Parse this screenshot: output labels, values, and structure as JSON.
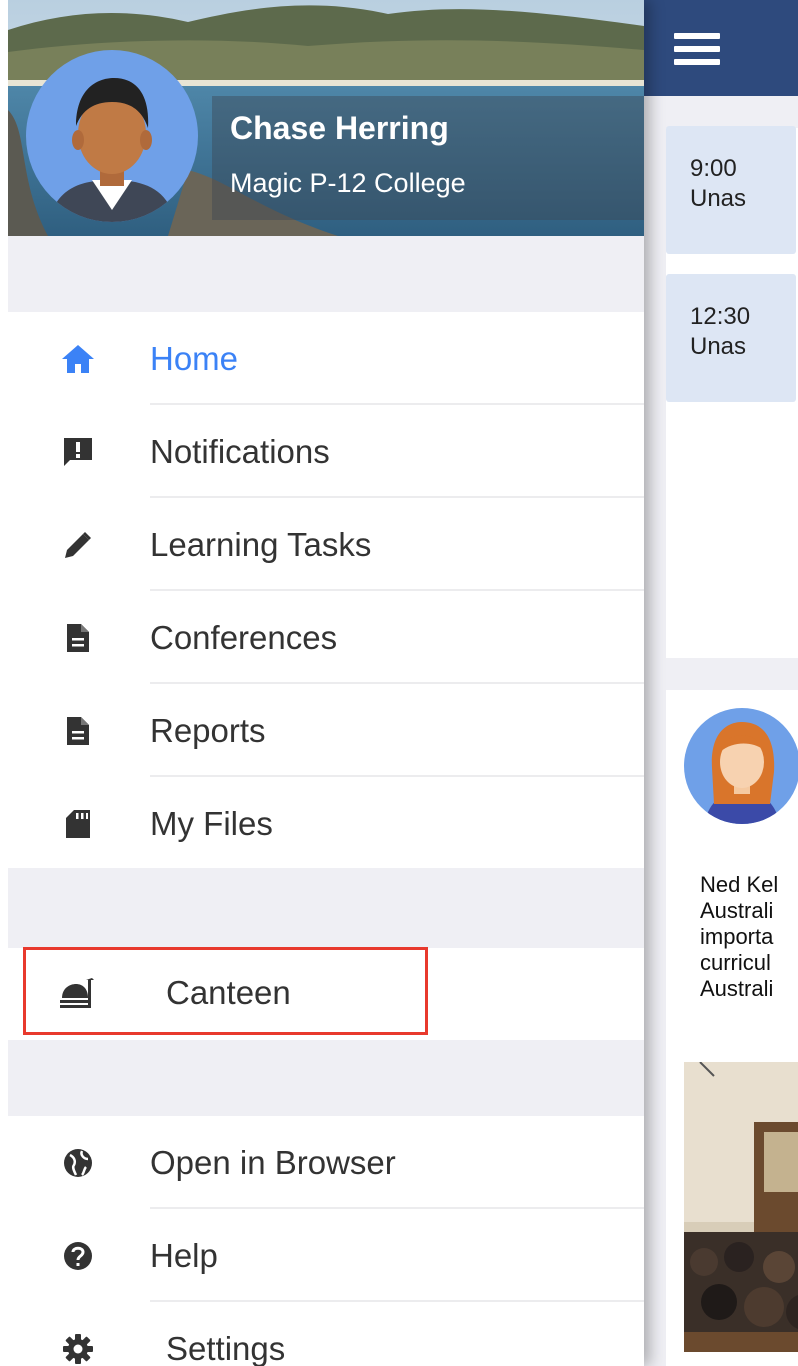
{
  "drawer": {
    "user": {
      "name": "Chase Herring",
      "school": "Magic P-12 College"
    },
    "items": [
      {
        "label": "Home",
        "icon": "home-icon",
        "active": true
      },
      {
        "label": "Notifications",
        "icon": "notification-alert-icon"
      },
      {
        "label": "Learning Tasks",
        "icon": "pencil-icon"
      },
      {
        "label": "Conferences",
        "icon": "document-icon"
      },
      {
        "label": "Reports",
        "icon": "document-icon"
      },
      {
        "label": "My Files",
        "icon": "sd-card-icon"
      }
    ],
    "canteen": {
      "label": "Canteen",
      "icon": "food-icon"
    },
    "footer_items": [
      {
        "label": "Open in Browser",
        "icon": "globe-icon"
      },
      {
        "label": "Help",
        "icon": "help-icon"
      },
      {
        "label": "Settings",
        "icon": "gear-icon"
      }
    ]
  },
  "background_app": {
    "schedule": [
      {
        "time": "9:00",
        "subject": "Unas"
      },
      {
        "time": "12:30",
        "subject": "Unas"
      }
    ],
    "news_text": [
      "Ned Kel",
      "Australi",
      "importa",
      "curricul",
      "Australi"
    ]
  },
  "colors": {
    "header_navy": "#2e4a7d",
    "accent_blue": "#3b82f6",
    "highlight_red": "#e8392d",
    "slot_bg": "#dde6f4"
  }
}
